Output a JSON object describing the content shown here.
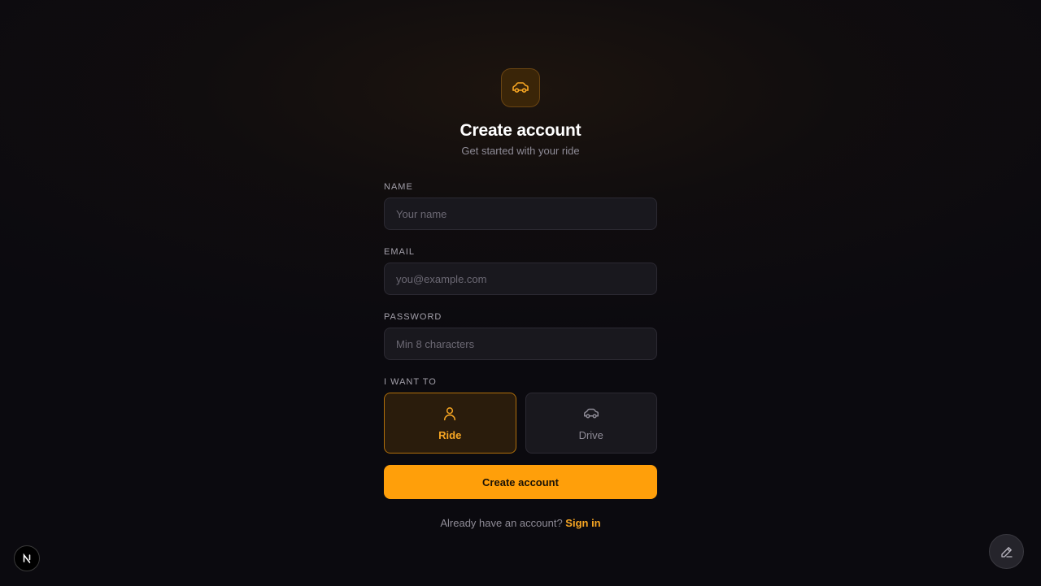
{
  "header": {
    "logo_icon": "car-icon",
    "title": "Create account",
    "subtitle": "Get started with your ride"
  },
  "form": {
    "name": {
      "label": "NAME",
      "placeholder": "Your name",
      "value": ""
    },
    "email": {
      "label": "EMAIL",
      "placeholder": "you@example.com",
      "value": ""
    },
    "password": {
      "label": "PASSWORD",
      "placeholder": "Min 8 characters",
      "value": ""
    },
    "role": {
      "label": "I WANT TO",
      "selected": "Ride",
      "options": [
        {
          "label": "Ride",
          "icon": "user-icon",
          "selected": true
        },
        {
          "label": "Drive",
          "icon": "car-icon",
          "selected": false
        }
      ]
    },
    "submit_label": "Create account"
  },
  "footer": {
    "prompt": "Already have an account?",
    "link_label": "Sign in"
  },
  "overlay": {
    "nextjs_badge_icon": "nextjs-logo-icon",
    "edit_button_icon": "pencil-icon"
  },
  "colors": {
    "accent": "#ff9f0a",
    "background": "#0b0a0f",
    "field_background": "#19181e",
    "text_muted": "#8e8b96"
  }
}
